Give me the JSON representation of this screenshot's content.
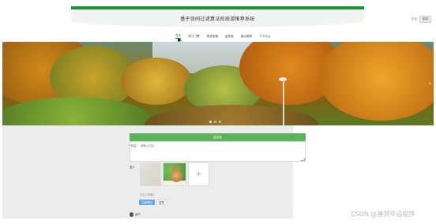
{
  "header": {
    "title": "基于协同过滤算法的旅游推荐系统",
    "lang_text": "中文",
    "login_label": "登录"
  },
  "nav": {
    "items": [
      {
        "label": "首页",
        "active": true
      },
      {
        "label": "热门门票",
        "active": false
      },
      {
        "label": "旅游攻略",
        "active": false
      },
      {
        "label": "留言板",
        "active": false
      },
      {
        "label": "景点推荐",
        "active": false
      },
      {
        "label": "个人中心",
        "active": false
      }
    ]
  },
  "form": {
    "header_label": "留言板",
    "content_label": "内容",
    "content_placeholder": "请输入内容",
    "image_label": "图片",
    "hint": "点击上传图片",
    "submit_label": "立即提交",
    "reset_label": "重置"
  },
  "comment": {
    "user_label": "用户"
  },
  "watermark": "CSDN @基努毕设程序"
}
